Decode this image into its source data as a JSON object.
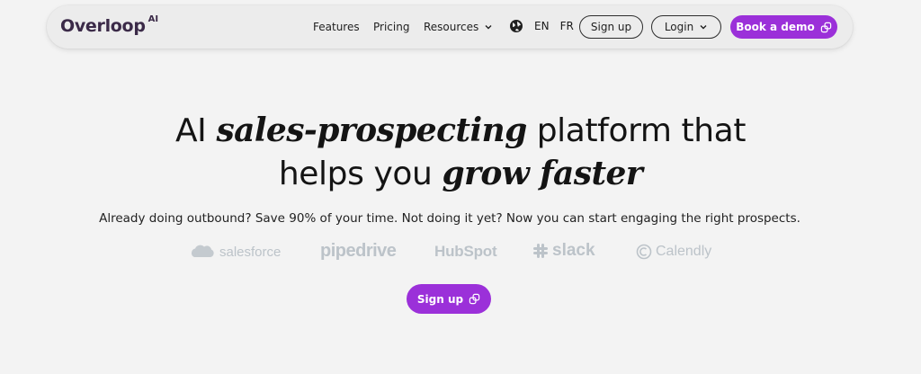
{
  "brand": {
    "name": "Overloop",
    "suffix": "AI"
  },
  "nav": {
    "features": "Features",
    "pricing": "Pricing",
    "resources": "Resources",
    "lang_en": "EN",
    "lang_fr": "FR",
    "signup": "Sign up",
    "login": "Login",
    "book_demo": "Book a demo"
  },
  "hero": {
    "line1_pre": "AI",
    "line1_em": "sales-prospecting",
    "line1_post": "platform that",
    "line2_pre": "helps you",
    "line2_em": "grow faster",
    "subtitle": "Already doing outbound? Save 90% of your time. Not doing it yet? Now you can start engaging the right prospects."
  },
  "integrations": {
    "salesforce": "salesforce",
    "pipedrive": "pipedrive",
    "hubspot": "HubSpot",
    "slack": "slack",
    "calendly": "Calendly"
  },
  "cta": {
    "label": "Sign up"
  },
  "colors": {
    "accent": "#9b30d9",
    "logo": "#3b2a48",
    "integration_gray": "#bcc3c9"
  }
}
